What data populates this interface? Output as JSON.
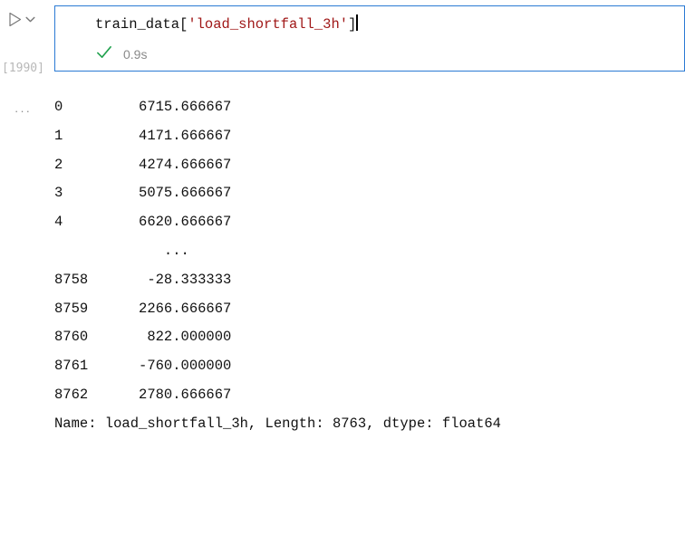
{
  "cell": {
    "exec_count_label": "[1990]",
    "code": {
      "object": "train_data",
      "open_bracket": "[",
      "string_literal": "'load_shortfall_3h'",
      "close_bracket": "]"
    },
    "status": {
      "time": "0.9s"
    }
  },
  "chart_data": {
    "type": "table",
    "columns": [
      "index",
      "value"
    ],
    "rows_head": [
      {
        "index": "0",
        "value": "6715.666667"
      },
      {
        "index": "1",
        "value": "4171.666667"
      },
      {
        "index": "2",
        "value": "4274.666667"
      },
      {
        "index": "3",
        "value": "5075.666667"
      },
      {
        "index": "4",
        "value": "6620.666667"
      }
    ],
    "ellipsis": "...     ",
    "rows_tail": [
      {
        "index": "8758",
        "value": "-28.333333"
      },
      {
        "index": "8759",
        "value": "2266.666667"
      },
      {
        "index": "8760",
        "value": "822.000000"
      },
      {
        "index": "8761",
        "value": "-760.000000"
      },
      {
        "index": "8762",
        "value": "2780.666667"
      }
    ],
    "footer": "Name: load_shortfall_3h, Length: 8763, dtype: float64",
    "series_name": "load_shortfall_3h",
    "length": 8763,
    "dtype": "float64"
  },
  "layout": {
    "index_width": 4,
    "value_width": 14
  }
}
